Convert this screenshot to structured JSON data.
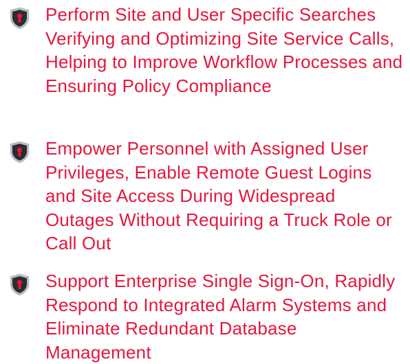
{
  "colors": {
    "accent": "#e3173e",
    "shield_outer": "#b8bcc2",
    "shield_inner": "#2a2d31",
    "keyhole": "#e3173e"
  },
  "features": [
    {
      "icon": "shield-keyhole-icon",
      "text": "Perform Site and User Specific Searches Verifying and Optimizing Site Service Calls, Helping to Improve Workflow Processes and Ensuring Policy Compliance"
    },
    {
      "icon": "shield-keyhole-icon",
      "text": "Empower Personnel with Assigned User Privileges, Enable Remote Guest Logins and Site Access During Widespread Outages Without Requiring a Truck Role or Call Out"
    },
    {
      "icon": "shield-keyhole-icon",
      "text": "Support Enterprise Single Sign-On, Rapidly Respond to Integrated Alarm Systems and Eliminate Redundant Database Management"
    }
  ]
}
